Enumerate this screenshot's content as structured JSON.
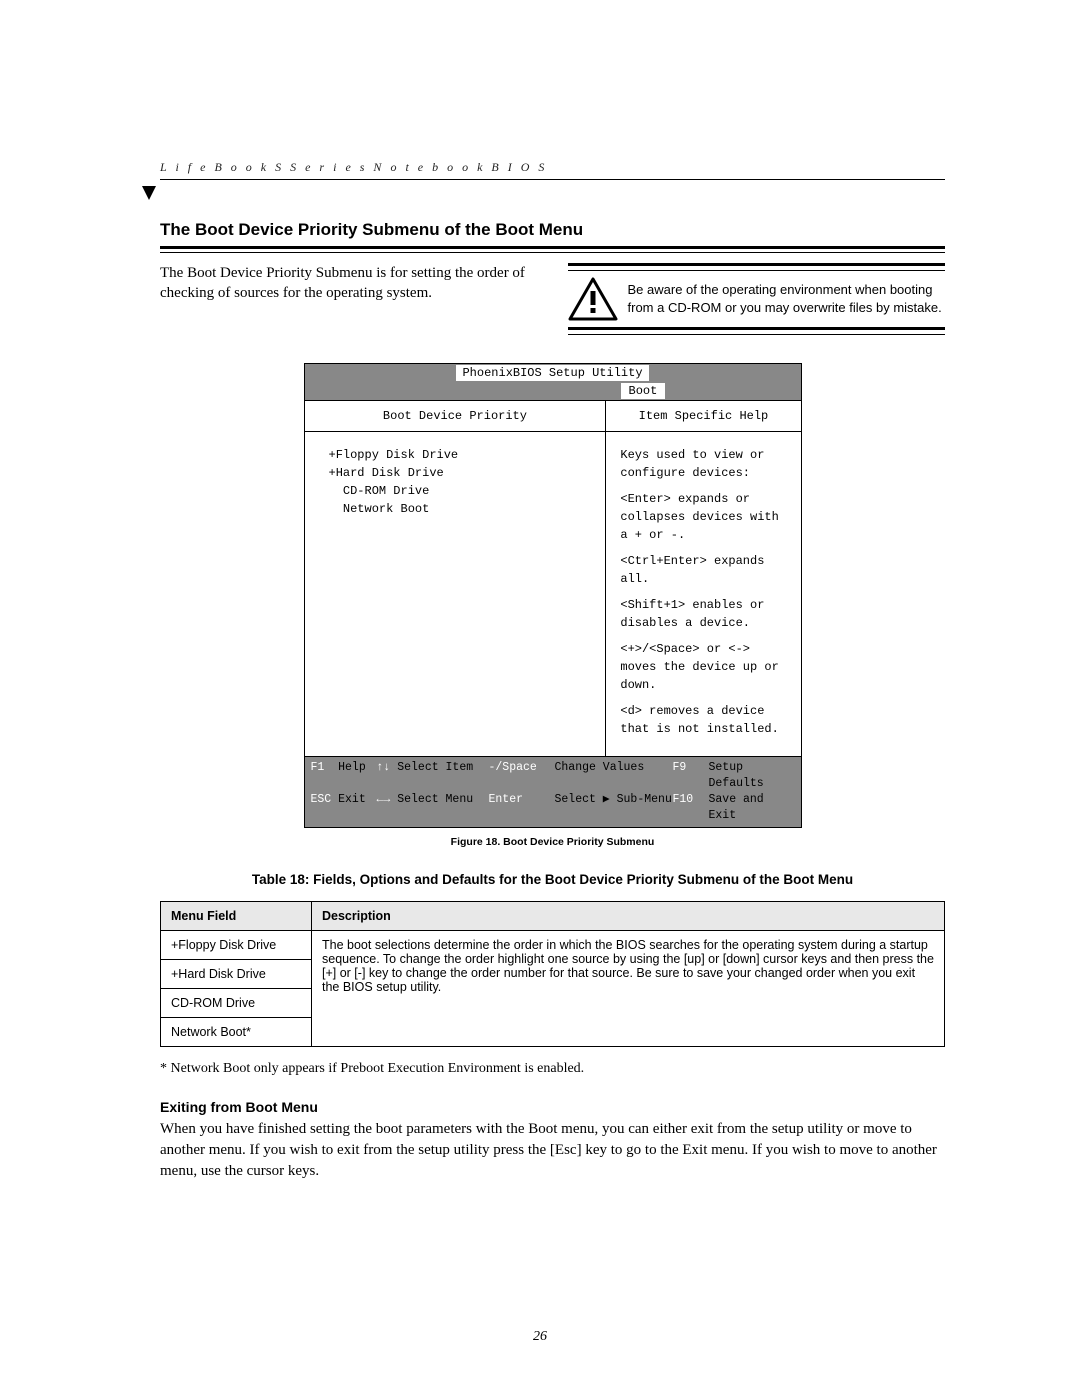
{
  "running_head": "L i f e B o o k   S   S e r i e s   N o t e b o o k   B I O S",
  "section_title": "The Boot Device Priority Submenu of the Boot Menu",
  "intro_text": "The Boot Device Priority Submenu is for setting the order of checking of sources for the operating system.",
  "warning_text": "Be aware of the operating environment when booting from a CD-ROM or you may overwrite files by mistake.",
  "bios": {
    "utility_title": "PhoenixBIOS Setup Utility",
    "menu_tab": "Boot",
    "left_title": "Boot Device Priority",
    "right_title": "Item Specific Help",
    "devices_raw": "+Floppy Disk Drive\n+Hard Disk Drive\n  CD-ROM Drive\n  Network Boot",
    "help_intro": "Keys used to view or configure devices:",
    "help_lines": [
      "<Enter> expands or collapses devices with a + or -.",
      "<Ctrl+Enter> expands all.",
      "<Shift+1> enables or disables a device.",
      "<+>/<Space> or <-> moves the device up or down.",
      "<d> removes a device that is not installed."
    ],
    "footer": {
      "r1": {
        "k1": "F1",
        "l1": "Help",
        "k2": "↑↓",
        "l2": "Select Item",
        "k3": "-/Space",
        "l3": "Change Values",
        "k4": "F9",
        "l4": "Setup Defaults"
      },
      "r2": {
        "k1": "ESC",
        "l1": "Exit",
        "k2": "←→",
        "l2": "Select Menu",
        "k3": "Enter",
        "l3": "Select ▶ Sub-Menu",
        "k4": "F10",
        "l4": "Save and Exit"
      }
    }
  },
  "figure_caption": "Figure 18.   Boot Device Priority Submenu",
  "table_caption": "Table 18: Fields, Options and Defaults for the Boot Device Priority Submenu of the Boot Menu",
  "table": {
    "head_field": "Menu Field",
    "head_desc": "Description",
    "rows": [
      "+Floppy Disk Drive",
      "+Hard Disk Drive",
      "CD-ROM Drive",
      "Network Boot*"
    ],
    "desc": "The boot selections determine the order in which the BIOS searches for the operating system during a startup sequence. To change the order highlight one source by using the [up] or [down] cursor keys and then press the [+] or [-] key to change the order number for that source. Be sure to save your changed order when you exit the BIOS setup utility."
  },
  "footnote": "* Network Boot only appears if Preboot Execution Environment is enabled.",
  "exiting_title": "Exiting from Boot Menu",
  "exiting_text": "When you have finished setting the boot parameters with the Boot menu, you can either exit from the setup utility or move to another menu. If you wish to exit from the setup utility press the [Esc] key to go to the Exit menu. If you wish to move to another menu, use the cursor keys.",
  "page_number": "26"
}
